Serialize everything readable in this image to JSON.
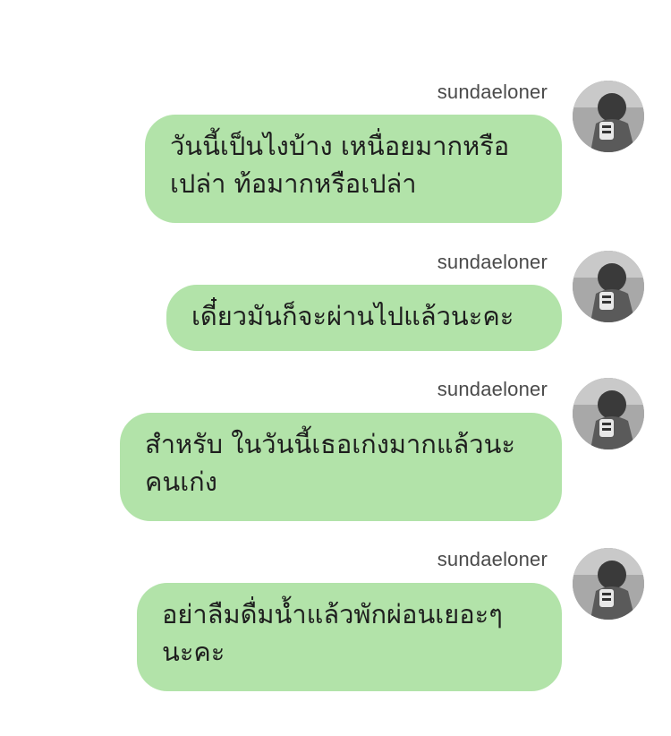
{
  "messages": [
    {
      "sender": "sundaeloner",
      "lines": [
        "วันนี้เป็นไงบ้าง เหนื่อยมากหรือ",
        "เปล่า ท้อมากหรือเปล่า"
      ]
    },
    {
      "sender": "sundaeloner",
      "lines": [
        "เดี๋ยวมันก็จะผ่านไปแล้วนะคะ"
      ]
    },
    {
      "sender": "sundaeloner",
      "lines": [
        "สำหรับ ในวันนี้เธอเก่งมากแล้วนะ",
        "คนเก่ง"
      ]
    },
    {
      "sender": "sundaeloner",
      "lines": [
        "อย่าลืมดื่มน้ำแล้วพักผ่อนเยอะๆ",
        "นะคะ"
      ]
    }
  ],
  "colors": {
    "bubble": "#b2e3a9",
    "sender_text": "#4a4a4a",
    "message_text": "#1e1e1e"
  },
  "icons": {
    "avatar": "profile-photo-avatar"
  }
}
